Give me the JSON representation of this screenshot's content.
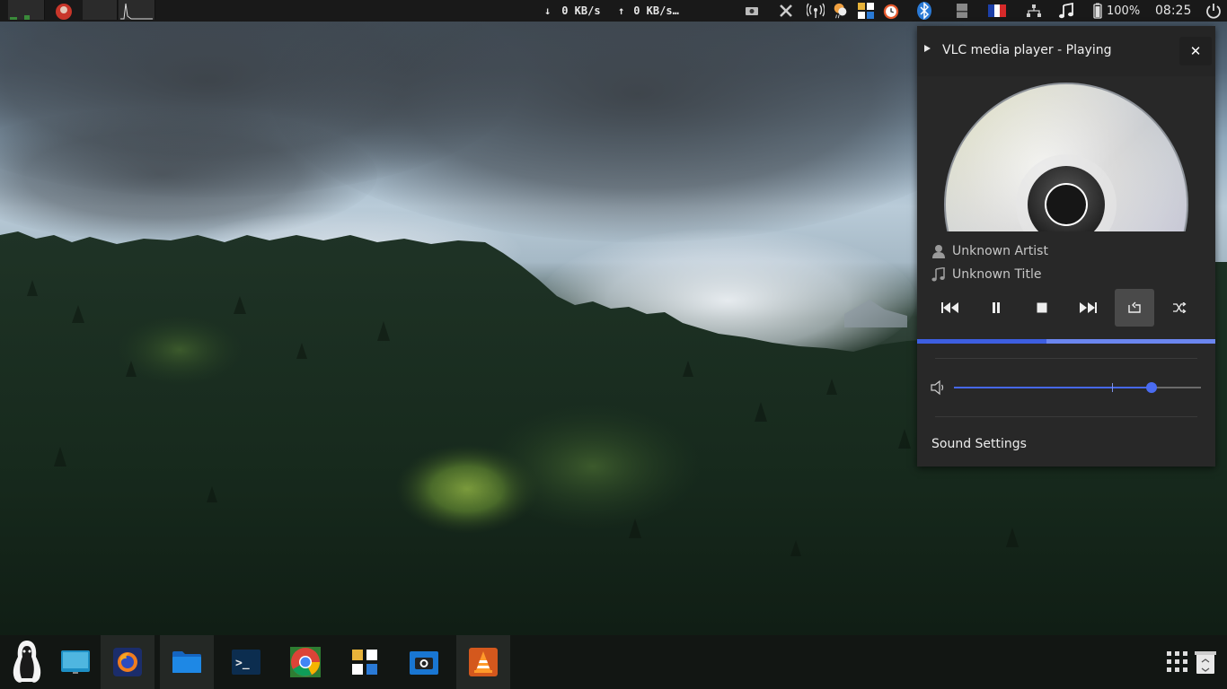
{
  "top_panel": {
    "download_arrow": "↓",
    "download_speed": "0 KB/s",
    "upload_arrow": "↑",
    "upload_speed": "0 KB/s…",
    "battery_percent": "100%",
    "clock": "08:25",
    "tray_icons": [
      "screenshot-icon",
      "x-icon",
      "wireless-icon",
      "weather-icon",
      "keyboard-layout-icon",
      "alarm-icon",
      "bluetooth-icon",
      "storage-icon",
      "french-flag-icon",
      "network-icon",
      "music-note-icon",
      "battery-icon",
      "power-icon"
    ],
    "workspace_applets": [
      "cpu-graph",
      "redshift-icon",
      "memory-graph",
      "load-graph"
    ]
  },
  "media_popup": {
    "title": "VLC media player - Playing",
    "close_symbol": "✕",
    "artist": "Unknown Artist",
    "track_title": "Unknown Title",
    "controls": [
      "previous-icon",
      "pause-icon",
      "stop-icon",
      "next-icon",
      "repeat-icon",
      "shuffle-icon"
    ],
    "repeat_active": true,
    "progress_fraction": 0.435,
    "volume_fraction": 0.8,
    "sound_settings_label": "Sound Settings"
  },
  "dock": {
    "items": [
      "menu-tux-icon",
      "display-icon",
      "firefox-icon",
      "files-icon",
      "terminal-icon",
      "chrome-icon",
      "keyboard-tool-icon",
      "screenshot-app-icon",
      "vlc-icon"
    ],
    "right_items": [
      "app-grid-icon",
      "trash-icon"
    ],
    "terminal_prompt": ">_"
  },
  "colors": {
    "accent": "#4a6cf2",
    "panel_bg": "#191919",
    "popup_bg": "#282828"
  }
}
